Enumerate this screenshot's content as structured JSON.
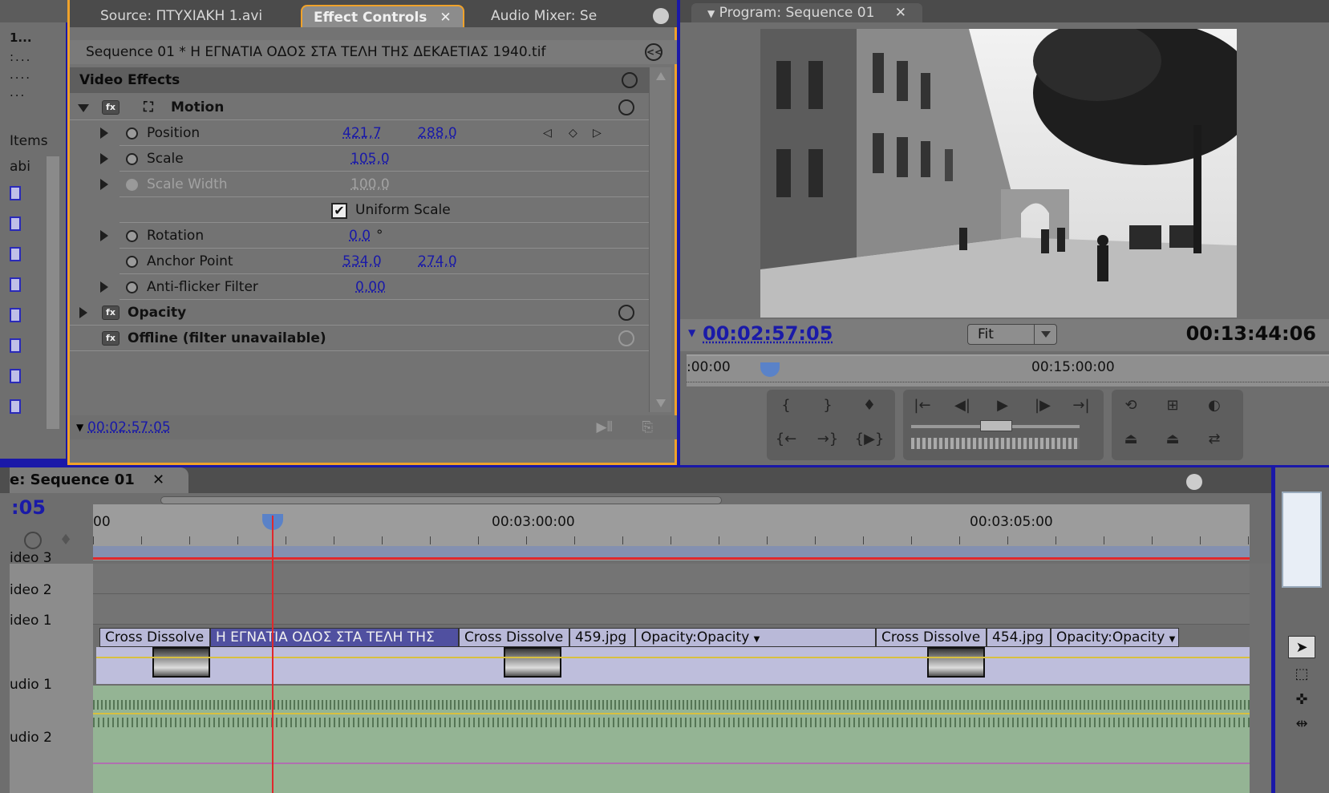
{
  "left_panel": {
    "title_fragment": "1...",
    "dots": [
      ":...",
      "....",
      "..."
    ],
    "items_label": "Items",
    "label_col": "abi"
  },
  "effect_controls": {
    "tabs": [
      {
        "label": "Source: ΠΤΥΧΙΑΚΗ 1.avi"
      },
      {
        "label": "Effect Controls"
      },
      {
        "label": "Audio Mixer: Se"
      }
    ],
    "sequence_line": "Sequence 01 * Η ΕΓΝΑΤΙΑ ΟΔΟΣ ΣΤΑ ΤΕΛΗ ΤΗΣ ΔΕΚΑΕΤΙΑΣ 1940.tif",
    "video_effects_header": "Video Effects",
    "motion": {
      "label": "Motion",
      "position": {
        "label": "Position",
        "x": "421,7",
        "y": "288,0"
      },
      "scale": {
        "label": "Scale",
        "value": "105,0"
      },
      "scale_width": {
        "label": "Scale Width",
        "value": "100,0"
      },
      "uniform_scale": {
        "label": "Uniform Scale",
        "checked": true
      },
      "rotation": {
        "label": "Rotation",
        "value": "0,0",
        "unit": "°"
      },
      "anchor_point": {
        "label": "Anchor Point",
        "x": "534,0",
        "y": "274,0"
      },
      "anti_flicker": {
        "label": "Anti-flicker Filter",
        "value": "0,00"
      }
    },
    "opacity": {
      "label": "Opacity"
    },
    "offline": {
      "label": "Offline (filter unavailable)"
    },
    "current_time": "00:02:57:05"
  },
  "program": {
    "tab_label": "Program: Sequence 01",
    "timecode_current": "00:02:57:05",
    "timecode_duration": "00:13:44:06",
    "zoom_select": "Fit",
    "ruler_start": ":00:00",
    "ruler_mid": "00:15:00:00"
  },
  "timeline": {
    "tab_label": "e: Sequence 01",
    "timecode": ":05",
    "ruler_labels": [
      "00",
      "00:03:00:00",
      "00:03:05:00"
    ],
    "tracks": {
      "video3": "ideo 3",
      "video2": "ideo 2",
      "video1": "ideo 1",
      "audio1": "udio 1",
      "audio2": "udio 2"
    },
    "clips": [
      {
        "label": "Cross Dissolve"
      },
      {
        "label": "Η ΕΓΝΑΤΙΑ ΟΔΟΣ ΣΤΑ ΤΕΛΗ ΤΗΣ"
      },
      {
        "label": "Cross Dissolve"
      },
      {
        "label": "459.jpg"
      },
      {
        "label": "Opacity:Opacity"
      },
      {
        "label": "Cross Dissolve"
      },
      {
        "label": "454.jpg"
      },
      {
        "label": "Opacity:Opacity"
      }
    ]
  },
  "colors": {
    "accent_orange": "#f0a22a",
    "timecode_blue": "#1a1aa8",
    "playhead_red": "#e0282c",
    "desktop_blue": "#1a18a8"
  }
}
